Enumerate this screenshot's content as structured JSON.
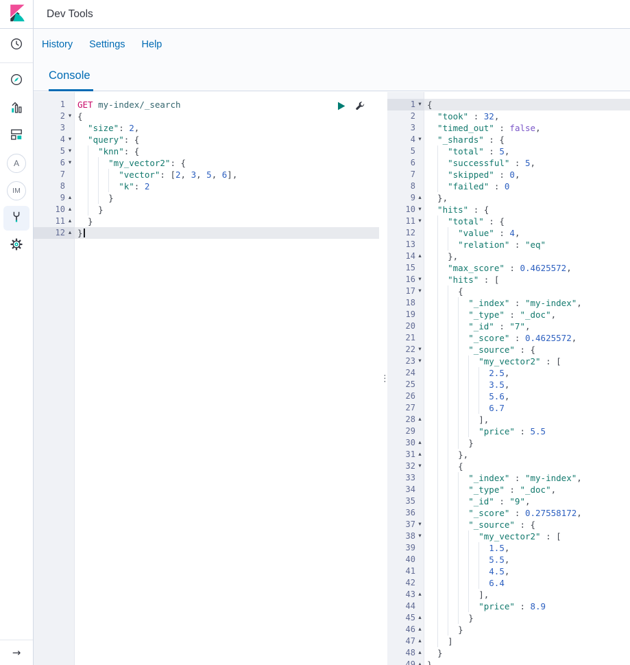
{
  "topbar": {
    "title": "Dev Tools"
  },
  "nav": {
    "links": [
      "History",
      "Settings",
      "Help"
    ]
  },
  "tab": {
    "label": "Console"
  },
  "sidebar": {
    "avatar_a": "A",
    "avatar_im": "IM",
    "collapse_arrow": "→"
  },
  "colors": {
    "accent_blue": "#006bb4",
    "brand_teal": "#00bfb3",
    "brand_pink": "#f04e98",
    "method_pink": "#c80a68",
    "key_teal": "#12796d",
    "number_blue": "#2d60c0",
    "boolean_purple": "#7a56c8",
    "play_green": "#017d73"
  },
  "editor": {
    "divider_handle": "⋮",
    "fold_open": "▾",
    "fold_close": "▴",
    "request_lines": [
      {
        "n": 1,
        "L": 0,
        "f": "",
        "s": [
          [
            "GET",
            "m"
          ],
          [
            " ",
            "p"
          ],
          [
            "my-index/_search",
            "u"
          ]
        ]
      },
      {
        "n": 2,
        "L": 0,
        "f": "o",
        "s": [
          [
            "{",
            "p"
          ]
        ]
      },
      {
        "n": 3,
        "L": 1,
        "f": "",
        "s": [
          [
            "\"size\"",
            "k"
          ],
          [
            ": ",
            "p"
          ],
          [
            "2",
            "n"
          ],
          [
            ",",
            "p"
          ]
        ]
      },
      {
        "n": 4,
        "L": 1,
        "f": "o",
        "s": [
          [
            "\"query\"",
            "k"
          ],
          [
            ": ",
            "p"
          ],
          [
            "{",
            "p"
          ]
        ]
      },
      {
        "n": 5,
        "L": 2,
        "f": "o",
        "s": [
          [
            "\"knn\"",
            "k"
          ],
          [
            ": ",
            "p"
          ],
          [
            "{",
            "p"
          ]
        ]
      },
      {
        "n": 6,
        "L": 3,
        "f": "o",
        "s": [
          [
            "\"my_vector2\"",
            "k"
          ],
          [
            ": ",
            "p"
          ],
          [
            "{",
            "p"
          ]
        ]
      },
      {
        "n": 7,
        "L": 4,
        "f": "",
        "s": [
          [
            "\"vector\"",
            "k"
          ],
          [
            ": [",
            "p"
          ],
          [
            "2",
            "n"
          ],
          [
            ", ",
            "p"
          ],
          [
            "3",
            "n"
          ],
          [
            ", ",
            "p"
          ],
          [
            "5",
            "n"
          ],
          [
            ", ",
            "p"
          ],
          [
            "6",
            "n"
          ],
          [
            "],",
            "p"
          ]
        ]
      },
      {
        "n": 8,
        "L": 4,
        "f": "",
        "s": [
          [
            "\"k\"",
            "k"
          ],
          [
            ": ",
            "p"
          ],
          [
            "2",
            "n"
          ]
        ]
      },
      {
        "n": 9,
        "L": 3,
        "f": "c",
        "s": [
          [
            "}",
            "p"
          ]
        ]
      },
      {
        "n": 10,
        "L": 2,
        "f": "c",
        "s": [
          [
            "}",
            "p"
          ]
        ]
      },
      {
        "n": 11,
        "L": 1,
        "f": "c",
        "s": [
          [
            "}",
            "p"
          ]
        ]
      },
      {
        "n": 12,
        "L": 0,
        "f": "c",
        "hl": true,
        "cur": true,
        "s": [
          [
            "}",
            "p"
          ]
        ]
      }
    ],
    "response_lines": [
      {
        "n": 1,
        "L": 0,
        "f": "o",
        "hl": true,
        "s": [
          [
            "{",
            "p"
          ]
        ]
      },
      {
        "n": 2,
        "L": 1,
        "f": "",
        "s": [
          [
            "\"took\"",
            "k"
          ],
          [
            " : ",
            "p"
          ],
          [
            "32",
            "n"
          ],
          [
            ",",
            "p"
          ]
        ]
      },
      {
        "n": 3,
        "L": 1,
        "f": "",
        "s": [
          [
            "\"timed_out\"",
            "k"
          ],
          [
            " : ",
            "p"
          ],
          [
            "false",
            "b"
          ],
          [
            ",",
            "p"
          ]
        ]
      },
      {
        "n": 4,
        "L": 1,
        "f": "o",
        "s": [
          [
            "\"_shards\"",
            "k"
          ],
          [
            " : ",
            "p"
          ],
          [
            "{",
            "p"
          ]
        ]
      },
      {
        "n": 5,
        "L": 2,
        "f": "",
        "s": [
          [
            "\"total\"",
            "k"
          ],
          [
            " : ",
            "p"
          ],
          [
            "5",
            "n"
          ],
          [
            ",",
            "p"
          ]
        ]
      },
      {
        "n": 6,
        "L": 2,
        "f": "",
        "s": [
          [
            "\"successful\"",
            "k"
          ],
          [
            " : ",
            "p"
          ],
          [
            "5",
            "n"
          ],
          [
            ",",
            "p"
          ]
        ]
      },
      {
        "n": 7,
        "L": 2,
        "f": "",
        "s": [
          [
            "\"skipped\"",
            "k"
          ],
          [
            " : ",
            "p"
          ],
          [
            "0",
            "n"
          ],
          [
            ",",
            "p"
          ]
        ]
      },
      {
        "n": 8,
        "L": 2,
        "f": "",
        "s": [
          [
            "\"failed\"",
            "k"
          ],
          [
            " : ",
            "p"
          ],
          [
            "0",
            "n"
          ]
        ]
      },
      {
        "n": 9,
        "L": 1,
        "f": "c",
        "s": [
          [
            "},",
            "p"
          ]
        ]
      },
      {
        "n": 10,
        "L": 1,
        "f": "o",
        "s": [
          [
            "\"hits\"",
            "k"
          ],
          [
            " : ",
            "p"
          ],
          [
            "{",
            "p"
          ]
        ]
      },
      {
        "n": 11,
        "L": 2,
        "f": "o",
        "s": [
          [
            "\"total\"",
            "k"
          ],
          [
            " : ",
            "p"
          ],
          [
            "{",
            "p"
          ]
        ]
      },
      {
        "n": 12,
        "L": 3,
        "f": "",
        "s": [
          [
            "\"value\"",
            "k"
          ],
          [
            " : ",
            "p"
          ],
          [
            "4",
            "n"
          ],
          [
            ",",
            "p"
          ]
        ]
      },
      {
        "n": 13,
        "L": 3,
        "f": "",
        "s": [
          [
            "\"relation\"",
            "k"
          ],
          [
            " : ",
            "p"
          ],
          [
            "\"eq\"",
            "k"
          ]
        ]
      },
      {
        "n": 14,
        "L": 2,
        "f": "c",
        "s": [
          [
            "},",
            "p"
          ]
        ]
      },
      {
        "n": 15,
        "L": 2,
        "f": "",
        "s": [
          [
            "\"max_score\"",
            "k"
          ],
          [
            " : ",
            "p"
          ],
          [
            "0.4625572",
            "n"
          ],
          [
            ",",
            "p"
          ]
        ]
      },
      {
        "n": 16,
        "L": 2,
        "f": "o",
        "s": [
          [
            "\"hits\"",
            "k"
          ],
          [
            " : ",
            "p"
          ],
          [
            "[",
            "p"
          ]
        ]
      },
      {
        "n": 17,
        "L": 3,
        "f": "o",
        "s": [
          [
            "{",
            "p"
          ]
        ]
      },
      {
        "n": 18,
        "L": 4,
        "f": "",
        "s": [
          [
            "\"_index\"",
            "k"
          ],
          [
            " : ",
            "p"
          ],
          [
            "\"my-index\"",
            "k"
          ],
          [
            ",",
            "p"
          ]
        ]
      },
      {
        "n": 19,
        "L": 4,
        "f": "",
        "s": [
          [
            "\"_type\"",
            "k"
          ],
          [
            " : ",
            "p"
          ],
          [
            "\"_doc\"",
            "k"
          ],
          [
            ",",
            "p"
          ]
        ]
      },
      {
        "n": 20,
        "L": 4,
        "f": "",
        "s": [
          [
            "\"_id\"",
            "k"
          ],
          [
            " : ",
            "p"
          ],
          [
            "\"7\"",
            "k"
          ],
          [
            ",",
            "p"
          ]
        ]
      },
      {
        "n": 21,
        "L": 4,
        "f": "",
        "s": [
          [
            "\"_score\"",
            "k"
          ],
          [
            " : ",
            "p"
          ],
          [
            "0.4625572",
            "n"
          ],
          [
            ",",
            "p"
          ]
        ]
      },
      {
        "n": 22,
        "L": 4,
        "f": "o",
        "s": [
          [
            "\"_source\"",
            "k"
          ],
          [
            " : ",
            "p"
          ],
          [
            "{",
            "p"
          ]
        ]
      },
      {
        "n": 23,
        "L": 5,
        "f": "o",
        "s": [
          [
            "\"my_vector2\"",
            "k"
          ],
          [
            " : ",
            "p"
          ],
          [
            "[",
            "p"
          ]
        ]
      },
      {
        "n": 24,
        "L": 6,
        "f": "",
        "s": [
          [
            "2.5",
            "n"
          ],
          [
            ",",
            "p"
          ]
        ]
      },
      {
        "n": 25,
        "L": 6,
        "f": "",
        "s": [
          [
            "3.5",
            "n"
          ],
          [
            ",",
            "p"
          ]
        ]
      },
      {
        "n": 26,
        "L": 6,
        "f": "",
        "s": [
          [
            "5.6",
            "n"
          ],
          [
            ",",
            "p"
          ]
        ]
      },
      {
        "n": 27,
        "L": 6,
        "f": "",
        "s": [
          [
            "6.7",
            "n"
          ]
        ]
      },
      {
        "n": 28,
        "L": 5,
        "f": "c",
        "s": [
          [
            "],",
            "p"
          ]
        ]
      },
      {
        "n": 29,
        "L": 5,
        "f": "",
        "s": [
          [
            "\"price\"",
            "k"
          ],
          [
            " : ",
            "p"
          ],
          [
            "5.5",
            "n"
          ]
        ]
      },
      {
        "n": 30,
        "L": 4,
        "f": "c",
        "s": [
          [
            "}",
            "p"
          ]
        ]
      },
      {
        "n": 31,
        "L": 3,
        "f": "c",
        "s": [
          [
            "},",
            "p"
          ]
        ]
      },
      {
        "n": 32,
        "L": 3,
        "f": "o",
        "s": [
          [
            "{",
            "p"
          ]
        ]
      },
      {
        "n": 33,
        "L": 4,
        "f": "",
        "s": [
          [
            "\"_index\"",
            "k"
          ],
          [
            " : ",
            "p"
          ],
          [
            "\"my-index\"",
            "k"
          ],
          [
            ",",
            "p"
          ]
        ]
      },
      {
        "n": 34,
        "L": 4,
        "f": "",
        "s": [
          [
            "\"_type\"",
            "k"
          ],
          [
            " : ",
            "p"
          ],
          [
            "\"_doc\"",
            "k"
          ],
          [
            ",",
            "p"
          ]
        ]
      },
      {
        "n": 35,
        "L": 4,
        "f": "",
        "s": [
          [
            "\"_id\"",
            "k"
          ],
          [
            " : ",
            "p"
          ],
          [
            "\"9\"",
            "k"
          ],
          [
            ",",
            "p"
          ]
        ]
      },
      {
        "n": 36,
        "L": 4,
        "f": "",
        "s": [
          [
            "\"_score\"",
            "k"
          ],
          [
            " : ",
            "p"
          ],
          [
            "0.27558172",
            "n"
          ],
          [
            ",",
            "p"
          ]
        ]
      },
      {
        "n": 37,
        "L": 4,
        "f": "o",
        "s": [
          [
            "\"_source\"",
            "k"
          ],
          [
            " : ",
            "p"
          ],
          [
            "{",
            "p"
          ]
        ]
      },
      {
        "n": 38,
        "L": 5,
        "f": "o",
        "s": [
          [
            "\"my_vector2\"",
            "k"
          ],
          [
            " : ",
            "p"
          ],
          [
            "[",
            "p"
          ]
        ]
      },
      {
        "n": 39,
        "L": 6,
        "f": "",
        "s": [
          [
            "1.5",
            "n"
          ],
          [
            ",",
            "p"
          ]
        ]
      },
      {
        "n": 40,
        "L": 6,
        "f": "",
        "s": [
          [
            "5.5",
            "n"
          ],
          [
            ",",
            "p"
          ]
        ]
      },
      {
        "n": 41,
        "L": 6,
        "f": "",
        "s": [
          [
            "4.5",
            "n"
          ],
          [
            ",",
            "p"
          ]
        ]
      },
      {
        "n": 42,
        "L": 6,
        "f": "",
        "s": [
          [
            "6.4",
            "n"
          ]
        ]
      },
      {
        "n": 43,
        "L": 5,
        "f": "c",
        "s": [
          [
            "],",
            "p"
          ]
        ]
      },
      {
        "n": 44,
        "L": 5,
        "f": "",
        "s": [
          [
            "\"price\"",
            "k"
          ],
          [
            " : ",
            "p"
          ],
          [
            "8.9",
            "n"
          ]
        ]
      },
      {
        "n": 45,
        "L": 4,
        "f": "c",
        "s": [
          [
            "}",
            "p"
          ]
        ]
      },
      {
        "n": 46,
        "L": 3,
        "f": "c",
        "s": [
          [
            "}",
            "p"
          ]
        ]
      },
      {
        "n": 47,
        "L": 2,
        "f": "c",
        "s": [
          [
            "]",
            "p"
          ]
        ]
      },
      {
        "n": 48,
        "L": 1,
        "f": "c",
        "s": [
          [
            "}",
            "p"
          ]
        ]
      },
      {
        "n": 49,
        "L": 0,
        "f": "c",
        "s": [
          [
            "}",
            "p"
          ]
        ]
      }
    ]
  }
}
